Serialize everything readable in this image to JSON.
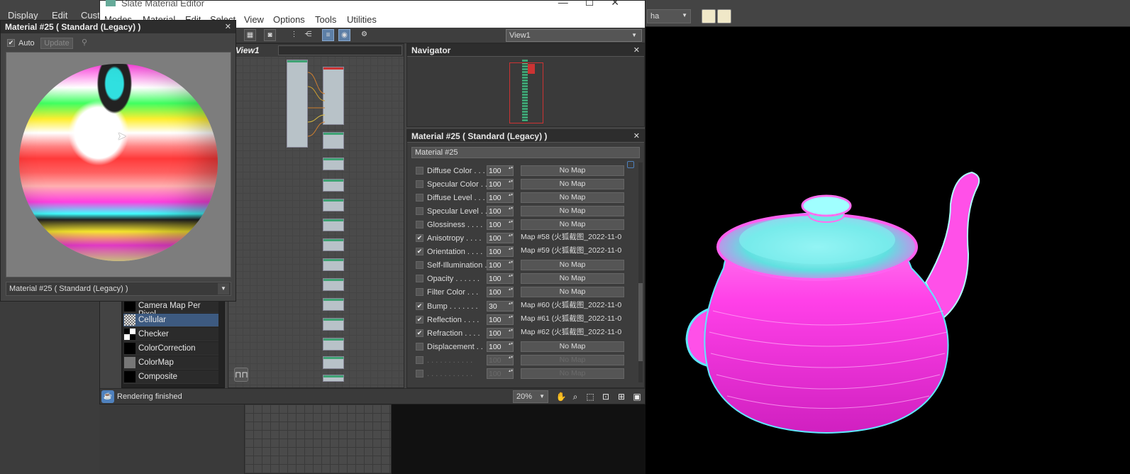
{
  "host": {
    "menu": [
      "Display",
      "Edit",
      "Cust"
    ],
    "alpha_dropdown": "ha"
  },
  "slate": {
    "title": "Slate Material Editor",
    "menu": [
      "Modes",
      "Material",
      "Edit",
      "Select",
      "View",
      "Options",
      "Tools",
      "Utilities"
    ],
    "view_dropdown": "View1",
    "view_tab_label": "View1"
  },
  "browser": {
    "items": [
      {
        "label": "Camera Map Per Pixel",
        "selected": false
      },
      {
        "label": "Cellular",
        "selected": true
      },
      {
        "label": "Checker",
        "selected": false
      },
      {
        "label": "ColorCorrection",
        "selected": false
      },
      {
        "label": "ColorMap",
        "selected": false
      },
      {
        "label": "Composite",
        "selected": false
      }
    ]
  },
  "navigator": {
    "title": "Navigator"
  },
  "properties": {
    "title": "Material #25  ( Standard (Legacy) )",
    "name_field": "Material #25",
    "rows": [
      {
        "label": "Diffuse Color . . .",
        "value": "100",
        "map": "No Map",
        "checked": false
      },
      {
        "label": "Specular Color  . .",
        "value": "100",
        "map": "No Map",
        "checked": false
      },
      {
        "label": "Diffuse Level . . .",
        "value": "100",
        "map": "No Map",
        "checked": false
      },
      {
        "label": "Specular Level  . .",
        "value": "100",
        "map": "No Map",
        "checked": false
      },
      {
        "label": "Glossiness . . . .",
        "value": "100",
        "map": "No Map",
        "checked": false
      },
      {
        "label": "Anisotropy  . . . .",
        "value": "100",
        "map": "Map #58 (火狐截图_2022-11-0",
        "checked": true
      },
      {
        "label": "Orientation . . . .",
        "value": "100",
        "map": "Map #59 (火狐截图_2022-11-0",
        "checked": true
      },
      {
        "label": "Self-Illumination .",
        "value": "100",
        "map": "No Map",
        "checked": false
      },
      {
        "label": "Opacity . . . . . .",
        "value": "100",
        "map": "No Map",
        "checked": false
      },
      {
        "label": "Filter Color  . . .",
        "value": "100",
        "map": "No Map",
        "checked": false
      },
      {
        "label": "Bump  . . . . . . .",
        "value": "30",
        "map": "Map #60 (火狐截图_2022-11-0",
        "checked": true
      },
      {
        "label": "Reflection  . . . .",
        "value": "100",
        "map": "Map #61 (火狐截图_2022-11-0",
        "checked": true
      },
      {
        "label": "Refraction  . . . .",
        "value": "100",
        "map": "Map #62 (火狐截图_2022-11-0",
        "checked": true
      },
      {
        "label": "Displacement  . .",
        "value": "100",
        "map": "No Map",
        "checked": false
      },
      {
        "label": ". . . . . . . . . . .",
        "value": "100",
        "map": "No Map",
        "checked": false,
        "dim": true
      },
      {
        "label": ". . . . . . . . . . .",
        "value": "100",
        "map": "No Map",
        "checked": false,
        "dim": true
      }
    ]
  },
  "status": {
    "text": "Rendering finished",
    "zoom": "20%"
  },
  "preview": {
    "title": "Material #25  ( Standard (Legacy) )",
    "auto_label": "Auto",
    "update_label": "Update",
    "material_dropdown": "Material #25  ( Standard (Legacy) )"
  },
  "colors": {
    "accent": "#5d7fa6",
    "selection": "#3d5a80",
    "node_header": "#3fa374",
    "teapot": "#ff40e8"
  }
}
